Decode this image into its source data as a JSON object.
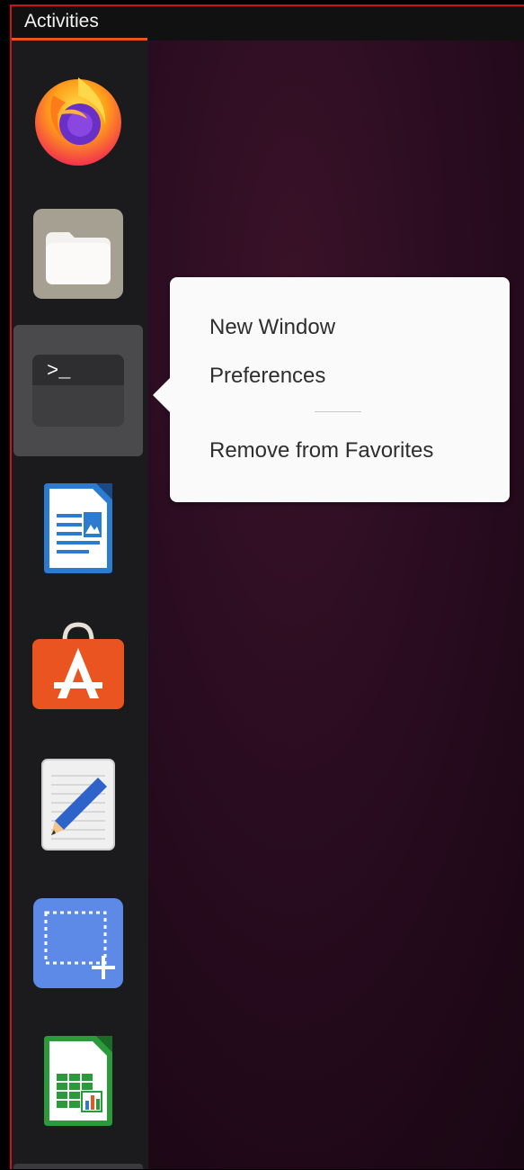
{
  "topbar": {
    "activities_label": "Activities"
  },
  "dock": {
    "items": [
      {
        "icon": "firefox-icon",
        "name": "Firefox"
      },
      {
        "icon": "files-icon",
        "name": "Files"
      },
      {
        "icon": "terminal-icon",
        "name": "Terminal",
        "active": true
      },
      {
        "icon": "libreoffice-writer-icon",
        "name": "LibreOffice Writer"
      },
      {
        "icon": "ubuntu-software-icon",
        "name": "Ubuntu Software"
      },
      {
        "icon": "text-editor-icon",
        "name": "Text Editor"
      },
      {
        "icon": "screenshot-icon",
        "name": "Screenshot"
      },
      {
        "icon": "libreoffice-calc-icon",
        "name": "LibreOffice Calc"
      }
    ],
    "terminal_prompt": ">_"
  },
  "context_menu": {
    "items": [
      "New Window",
      "Preferences",
      "Remove from Favorites"
    ]
  },
  "colors": {
    "accent": "#e95420",
    "dock_bg": "#1b1b1d",
    "active_item_bg": "#4a4a4c",
    "menu_bg": "#fafafa"
  }
}
